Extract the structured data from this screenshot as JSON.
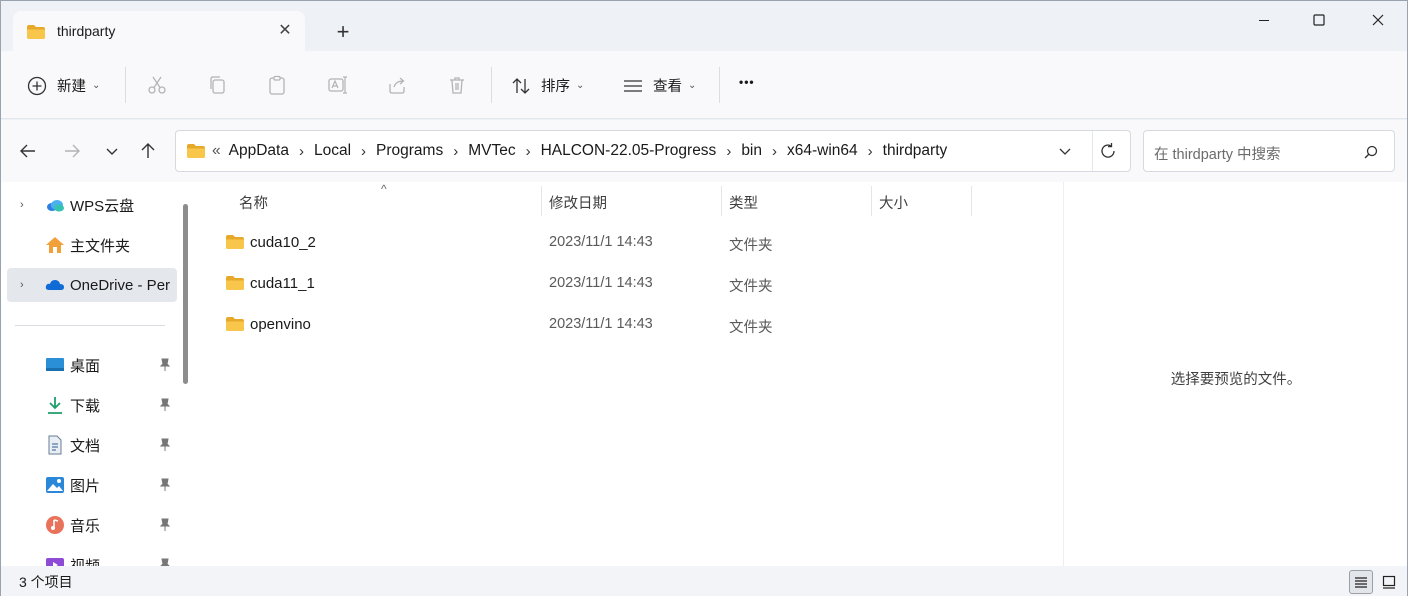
{
  "tab": {
    "title": "thirdparty",
    "close_glyph": "✕",
    "new_tab_glyph": "+"
  },
  "window_controls": {
    "minimize": "minimize-icon",
    "maximize": "maximize-icon",
    "close": "close-icon"
  },
  "toolbar": {
    "new_label": "新建",
    "sort_label": "排序",
    "view_label": "查看",
    "more_glyph": "•••",
    "icons": [
      "cut-icon",
      "copy-icon",
      "paste-icon",
      "rename-icon",
      "share-icon",
      "delete-icon"
    ]
  },
  "address": {
    "overflow_glyph": "«",
    "crumbs": [
      "AppData",
      "Local",
      "Programs",
      "MVTec",
      "HALCON-22.05-Progress",
      "bin",
      "x64-win64",
      "thirdparty"
    ],
    "separator": "›"
  },
  "search": {
    "placeholder": "在 thirdparty 中搜索"
  },
  "nav": {
    "items": [
      {
        "label": "WPS云盘",
        "icon": "wps-cloud-icon"
      },
      {
        "label": "主文件夹",
        "icon": "home-icon"
      },
      {
        "label": "OneDrive - Per",
        "icon": "onedrive-icon"
      },
      {
        "label": "桌面",
        "icon": "desktop-icon"
      },
      {
        "label": "下载",
        "icon": "download-icon"
      },
      {
        "label": "文档",
        "icon": "documents-icon"
      },
      {
        "label": "图片",
        "icon": "pictures-icon"
      },
      {
        "label": "音乐",
        "icon": "music-icon"
      },
      {
        "label": "视频",
        "icon": "videos-icon"
      }
    ]
  },
  "columns": {
    "name": "名称",
    "modified": "修改日期",
    "type": "类型",
    "size": "大小",
    "sort_glyph": "^"
  },
  "files": [
    {
      "name": "cuda10_2",
      "modified": "2023/11/1 14:43",
      "type": "文件夹"
    },
    {
      "name": "cuda11_1",
      "modified": "2023/11/1 14:43",
      "type": "文件夹"
    },
    {
      "name": "openvino",
      "modified": "2023/11/1 14:43",
      "type": "文件夹"
    }
  ],
  "preview": {
    "message": "选择要预览的文件。"
  },
  "status": {
    "count_text": "3 个项目"
  },
  "colors": {
    "folder": "#f8c64a",
    "folder_dark": "#e6a92a",
    "accent": "#0067c0",
    "selected_bg": "#e4e7ec"
  }
}
